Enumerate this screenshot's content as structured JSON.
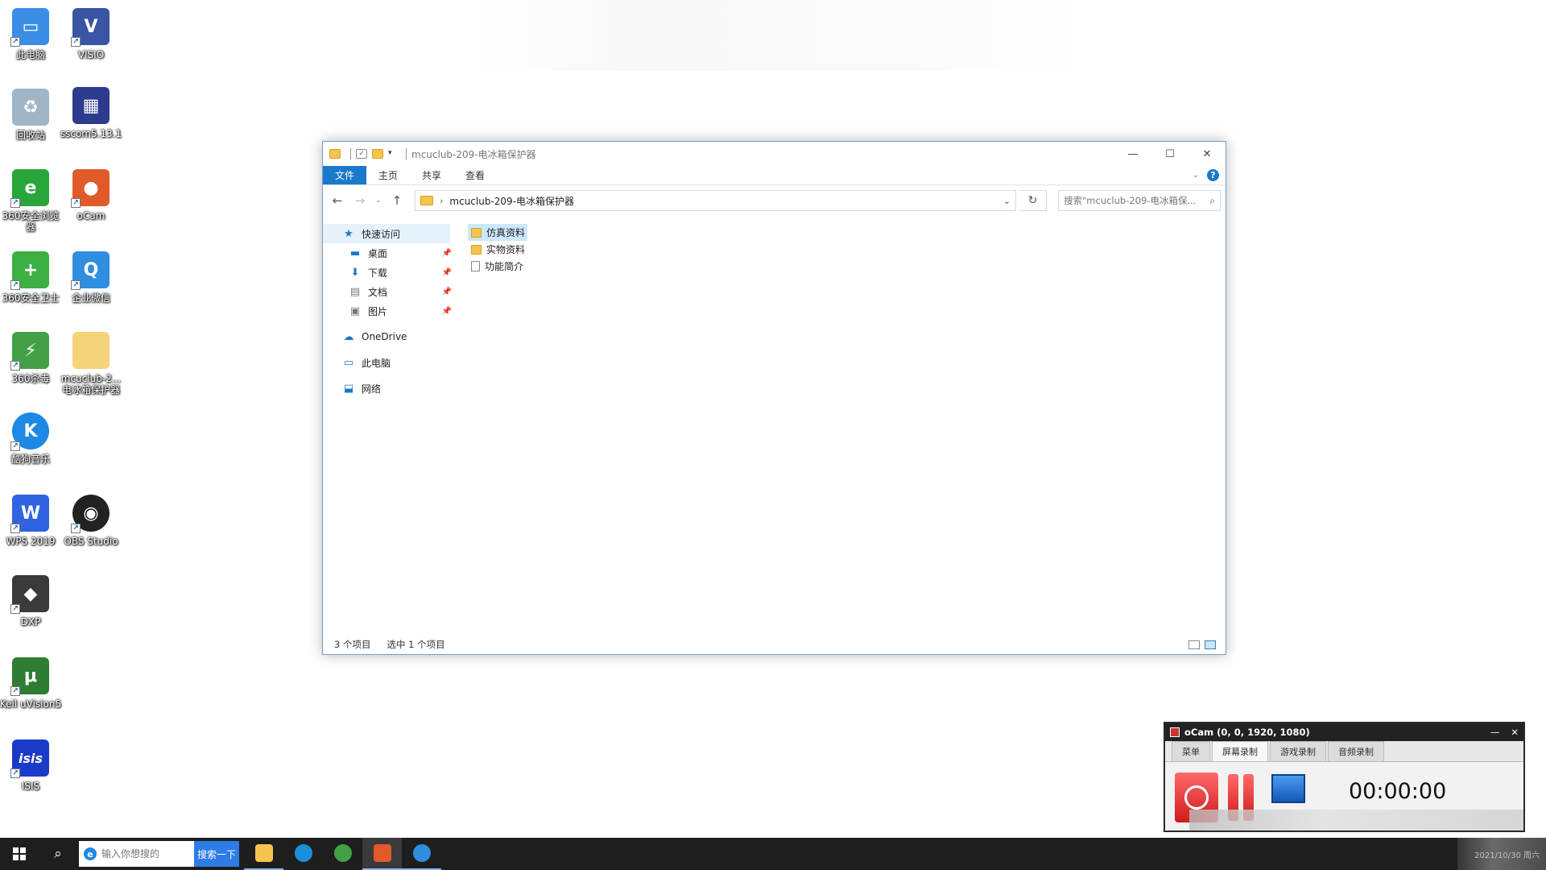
{
  "desktop": {
    "icons": [
      {
        "label": "此电脑",
        "icon": "computer-icon",
        "color": "#3a8ee6",
        "glyph": "▭"
      },
      {
        "label": "VISIO",
        "icon": "visio-icon",
        "color": "#3955a3",
        "glyph": "V"
      },
      {
        "label": "回收站",
        "icon": "recycle-bin-icon",
        "color": "#9fb6c8",
        "glyph": "♻"
      },
      {
        "label": "sscom5.13.1",
        "icon": "sscom-icon",
        "color": "#2d3b8f",
        "glyph": "▦"
      },
      {
        "label": "360安全浏览器",
        "icon": "360-browser-icon",
        "color": "#2aa53b",
        "glyph": "e"
      },
      {
        "label": "oCam",
        "icon": "ocam-icon",
        "color": "#e25a2a",
        "glyph": "●"
      },
      {
        "label": "360安全卫士",
        "icon": "360-security-icon",
        "color": "#3cb043",
        "glyph": "+"
      },
      {
        "label": "企业微信",
        "icon": "wecom-icon",
        "color": "#2f8ee0",
        "glyph": "Q"
      },
      {
        "label": "360杀毒",
        "icon": "360-antivirus-icon",
        "color": "#43a047",
        "glyph": "⚡"
      },
      {
        "label": "mcuclub-2...电冰箱保护器",
        "icon": "folder-icon",
        "color": "#f4d37a",
        "glyph": ""
      },
      {
        "label": "酷狗音乐",
        "icon": "kugou-icon",
        "color": "#1e88e5",
        "glyph": "K"
      },
      {
        "label": "WPS 2019",
        "icon": "wps-icon",
        "color": "#2f63e0",
        "glyph": "W"
      },
      {
        "label": "OBS Studio",
        "icon": "obs-icon",
        "color": "#222222",
        "glyph": "◉"
      },
      {
        "label": "DXP",
        "icon": "dxp-icon",
        "color": "#3a3a3a",
        "glyph": "◆"
      },
      {
        "label": "Keil uVision5",
        "icon": "keil-icon",
        "color": "#2e7d32",
        "glyph": "μ"
      },
      {
        "label": "ISIS",
        "icon": "isis-icon",
        "color": "#1a3bc8",
        "glyph": "isis"
      }
    ]
  },
  "explorer": {
    "title": "mcuclub-209-电冰箱保护器",
    "ribbon_tabs": [
      "文件",
      "主页",
      "共享",
      "查看"
    ],
    "address": {
      "crumb": "mcuclub-209-电冰箱保护器"
    },
    "search_placeholder": "搜索\"mcuclub-209-电冰箱保...",
    "nav": {
      "quick_access": "快速访问",
      "pinned": [
        "桌面",
        "下载",
        "文档",
        "图片"
      ],
      "onedrive": "OneDrive",
      "this_pc": "此电脑",
      "network": "网络"
    },
    "files": [
      {
        "name": "仿真资料",
        "type": "folder"
      },
      {
        "name": "实物资料",
        "type": "folder"
      },
      {
        "name": "功能简介",
        "type": "document"
      }
    ],
    "status": {
      "count": "3 个项目",
      "selected": "选中 1 个项目"
    }
  },
  "ocam": {
    "title": "oCam (0, 0, 1920, 1080)",
    "tabs": [
      "菜单",
      "屏幕录制",
      "游戏录制",
      "音频录制"
    ],
    "timer": "00:00:00"
  },
  "taskbar": {
    "search_placeholder": "输入你想搜的",
    "search_button": "搜索一下",
    "tray_text": "2021/10/30 周六",
    "apps": [
      {
        "name": "file-explorer",
        "color": "#f4c44e"
      },
      {
        "name": "edge",
        "color": "#1d8fd8"
      },
      {
        "name": "360-browser",
        "color": "#43a047"
      },
      {
        "name": "ocam",
        "color": "#e25a2a"
      },
      {
        "name": "wecom",
        "color": "#2f8ee0"
      }
    ]
  },
  "colors": {
    "accent": "#1979ca",
    "selection": "#cce8ff",
    "taskbar": "#1e1e1e"
  }
}
